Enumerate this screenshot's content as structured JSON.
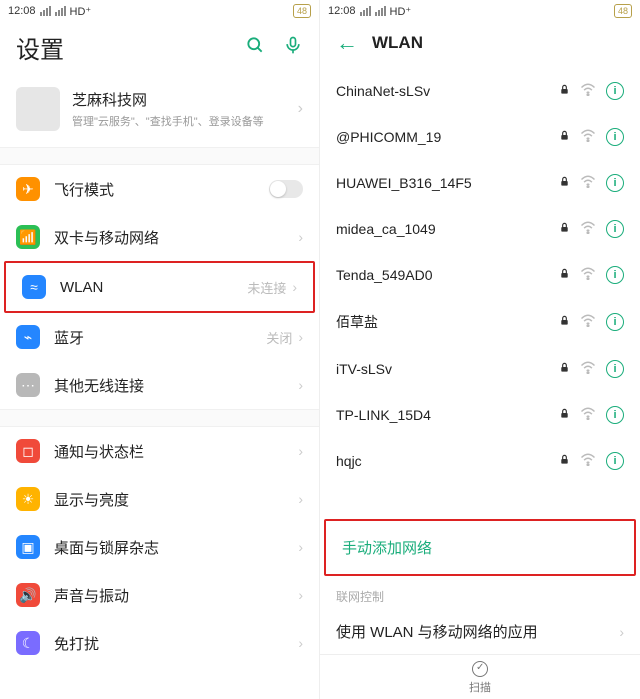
{
  "status": {
    "time": "12:08",
    "net_label": "HD",
    "battery": "48"
  },
  "left": {
    "title": "设置",
    "profile": {
      "name": "芝麻科技网",
      "sub": "管理\"云服务\"、\"查找手机\"、登录设备等"
    },
    "group1": [
      {
        "id": "airplane",
        "label": "飞行模式",
        "icon": "✈",
        "color": "ic-orange",
        "type": "toggle"
      },
      {
        "id": "dualsim",
        "label": "双卡与移动网络",
        "icon": "📶",
        "color": "ic-green",
        "type": "arrow"
      },
      {
        "id": "wlan",
        "label": "WLAN",
        "icon": "≈",
        "color": "ic-blue",
        "type": "arrow",
        "status": "未连接",
        "highlight": true
      },
      {
        "id": "bluetooth",
        "label": "蓝牙",
        "icon": "⌁",
        "color": "ic-blue",
        "type": "arrow",
        "status": "关闭"
      },
      {
        "id": "other",
        "label": "其他无线连接",
        "icon": "⋯",
        "color": "ic-grey",
        "type": "arrow"
      }
    ],
    "group2": [
      {
        "id": "notify",
        "label": "通知与状态栏",
        "icon": "◻",
        "color": "ic-red",
        "type": "arrow"
      },
      {
        "id": "display",
        "label": "显示与亮度",
        "icon": "☀",
        "color": "ic-yellow",
        "type": "arrow"
      },
      {
        "id": "desktop",
        "label": "桌面与锁屏杂志",
        "icon": "▣",
        "color": "ic-blue",
        "type": "arrow"
      },
      {
        "id": "sound",
        "label": "声音与振动",
        "icon": "🔊",
        "color": "ic-red",
        "type": "arrow"
      },
      {
        "id": "dnd",
        "label": "免打扰",
        "icon": "☾",
        "color": "ic-purple",
        "type": "arrow"
      }
    ]
  },
  "right": {
    "title": "WLAN",
    "networks": [
      {
        "ssid": "ChinaNet-sLSv",
        "locked": true
      },
      {
        "ssid": "@PHICOMM_19",
        "locked": true
      },
      {
        "ssid": "HUAWEI_B316_14F5",
        "locked": true
      },
      {
        "ssid": "midea_ca_1049",
        "locked": true
      },
      {
        "ssid": "Tenda_549AD0",
        "locked": true
      },
      {
        "ssid": "佰草盐",
        "locked": true
      },
      {
        "ssid": "iTV-sLSv",
        "locked": true
      },
      {
        "ssid": "TP-LINK_15D4",
        "locked": true
      },
      {
        "ssid": "hqjc",
        "locked": true
      }
    ],
    "manual_add": "手动添加网络",
    "section_label": "联网控制",
    "apps_row": "使用 WLAN 与移动网络的应用",
    "scan_label": "扫描"
  }
}
